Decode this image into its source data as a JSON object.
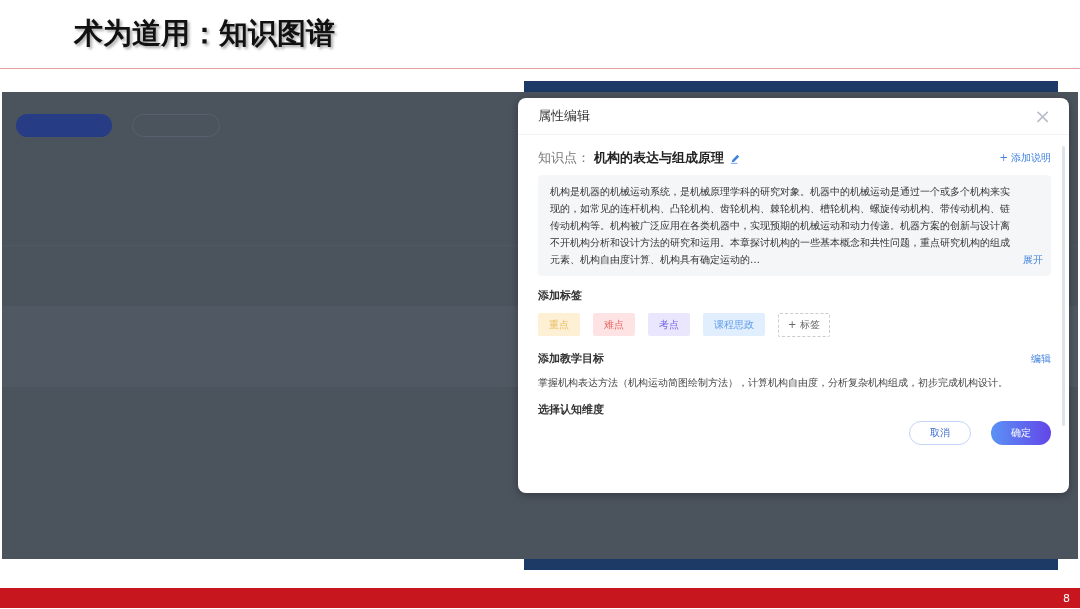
{
  "slide": {
    "title": "术为道用：知识图谱",
    "page_number": "8"
  },
  "dialog": {
    "title": "属性编辑",
    "close": "×",
    "point_label": "知识点：",
    "point_name": "机构的表达与组成原理",
    "add_note": "+ 添加说明",
    "description": "机构是机器的机械运动系统，是机械原理学科的研究对象。机器中的机械运动是通过一个或多个机构来实现的，如常见的连杆机构、凸轮机构、齿轮机构、棘轮机构、槽轮机构、螺旋传动机构、带传动机构、链传动机构等。机构被广泛应用在各类机器中，实现预期的机械运动和动力传递。机器方案的创新与设计离不开机构分析和设计方法的研究和运用。本章探讨机构的一些基本概念和共性问题，重点研究机构的组成元素、机构自由度计算、机构具有确定运动的…",
    "expand": "展开",
    "tags_heading": "添加标签",
    "tags": [
      {
        "label": "重点",
        "color": "#fdf0d5"
      },
      {
        "label": "难点",
        "color": "#fde3e3"
      },
      {
        "label": "考点",
        "color": "#e9e6fd"
      },
      {
        "label": "课程思政",
        "color": "#e1eefe"
      }
    ],
    "add_tag": "+ 标签",
    "goal_heading": "添加教学目标",
    "goal_edit": "编辑",
    "goal": "掌握机构表达方法（机构运动简图绘制方法），计算机构自由度，分析复杂机构组成，初步完成机构设计。",
    "dimension_heading": "选择认知维度",
    "cancel": "取消",
    "ok": "确定"
  }
}
